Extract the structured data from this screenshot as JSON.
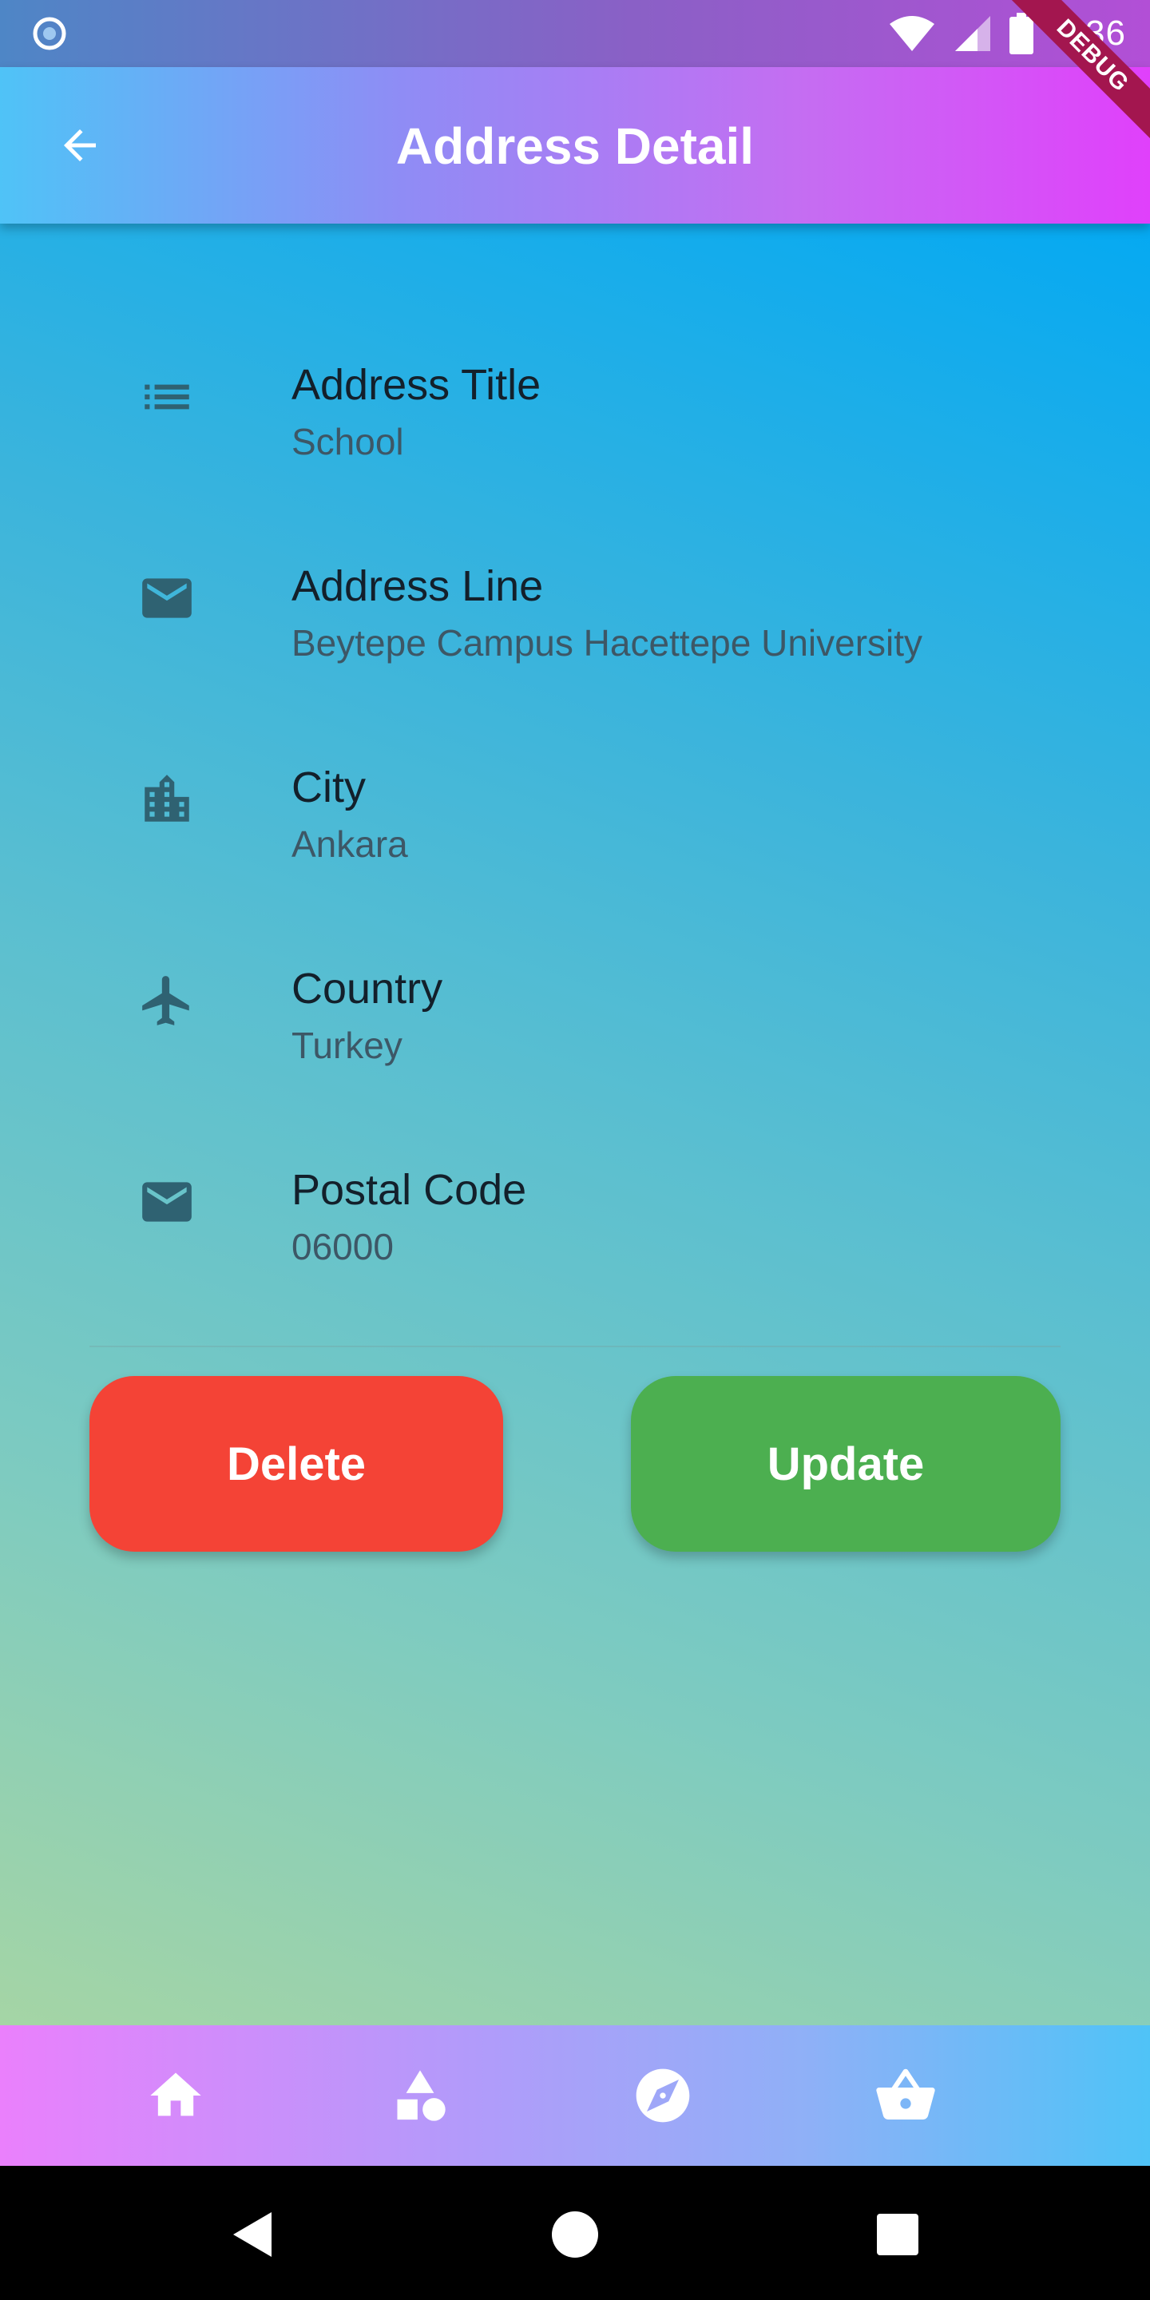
{
  "status_bar": {
    "time": "1:36"
  },
  "debug_banner": "DEBUG",
  "app_bar": {
    "title": "Address Detail",
    "back_icon": "arrow-back-icon"
  },
  "details": [
    {
      "icon": "list-icon",
      "label": "Address Title",
      "value": "School"
    },
    {
      "icon": "mail-icon",
      "label": "Address Line",
      "value": "Beytepe Campus Hacettepe University"
    },
    {
      "icon": "city-icon",
      "label": "City",
      "value": "Ankara"
    },
    {
      "icon": "airplane-icon",
      "label": "Country",
      "value": "Turkey"
    },
    {
      "icon": "mail-icon",
      "label": "Postal Code",
      "value": "06000"
    }
  ],
  "actions": {
    "delete_label": "Delete",
    "update_label": "Update"
  },
  "bottom_nav": {
    "items": [
      "home-icon",
      "category-icon",
      "explore-icon",
      "basket-icon"
    ]
  },
  "colors": {
    "delete": "#f44336",
    "update": "#4caf50",
    "icon": "#2f6272",
    "debug_ribbon": "#a3164f"
  }
}
